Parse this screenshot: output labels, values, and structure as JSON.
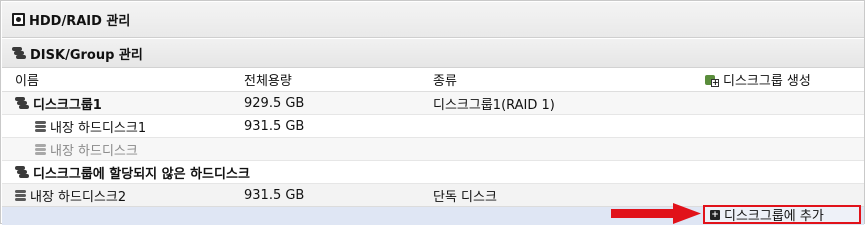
{
  "section": {
    "title": "HDD/RAID 관리",
    "icon": "hdd-icon"
  },
  "subsection": {
    "title": "DISK/Group 관리",
    "icon": "disks-icon"
  },
  "columns": {
    "name": "이름",
    "size": "전체용량",
    "type": "종류",
    "create_group": "디스크그룹 생성"
  },
  "rows": [
    {
      "name": "디스크그룹1",
      "size": "929.5 GB",
      "type": "디스크그룹1(RAID 1)",
      "icon": "disk-group-icon"
    },
    {
      "name": "내장 하드디스크1",
      "size": "931.5 GB",
      "type": "",
      "icon": "disk-icon"
    },
    {
      "name": "내장 하드디스크",
      "size": "",
      "type": "",
      "icon": "disk-icon"
    },
    {
      "name": "디스크그룹에 할당되지 않은 하드디스크",
      "size": "",
      "type": "",
      "icon": "disk-group-icon"
    },
    {
      "name": "내장 하드디스크2",
      "size": "931.5 GB",
      "type": "단독 디스크",
      "icon": "disk-icon"
    }
  ],
  "actions": {
    "add_to_group": "디스크그룹에 추가"
  },
  "colors": {
    "highlight_row": "#dfe6f4",
    "accent_red": "#e1121a"
  }
}
